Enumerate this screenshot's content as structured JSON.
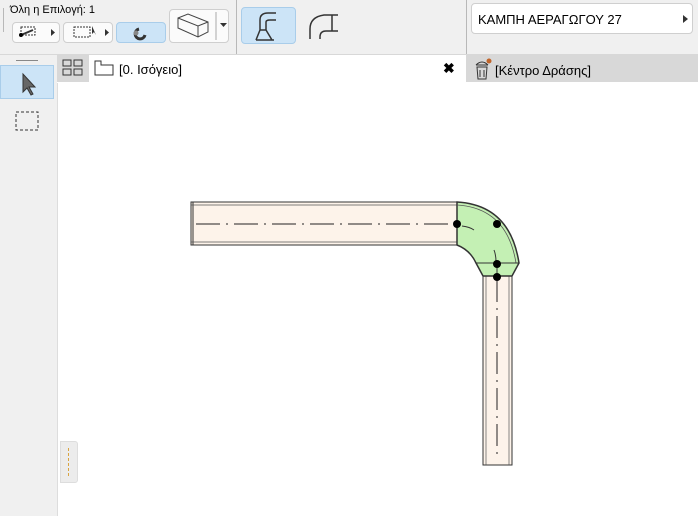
{
  "toolbar": {
    "selection_label": "Όλη η Επιλογή: 1",
    "element_name": "ΚΑΜΠΗ ΑΕΡΑΓΩΓΟΥ 27"
  },
  "tabs": {
    "view_tab": "[0. Ισόγειο]",
    "action_center": "[Κέντρο Δράσης]"
  },
  "colors": {
    "duct_fill": "#fdf3ea",
    "elbow_fill": "#c4f0b4",
    "active_bg": "#cce4f7"
  }
}
